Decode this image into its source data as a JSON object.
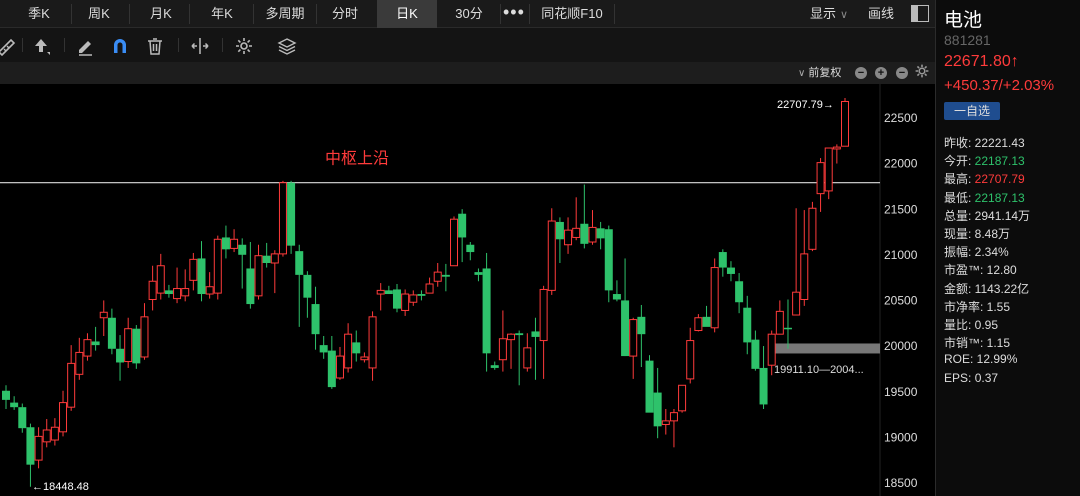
{
  "tabs": [
    {
      "label": "季K",
      "active": false
    },
    {
      "label": "周K",
      "active": false
    },
    {
      "label": "月K",
      "active": false
    },
    {
      "label": "年K",
      "active": false
    },
    {
      "label": "多周期",
      "active": false
    },
    {
      "label": "分时",
      "active": false
    },
    {
      "label": "日K",
      "active": true
    },
    {
      "label": "30分",
      "active": false
    },
    {
      "label": "同花顺F10",
      "active": false
    }
  ],
  "more_label": "•••",
  "display_label": "显示",
  "draw_label": "画线",
  "adjust_label": "前复权",
  "zoom_out_glyph": "−",
  "zoom_in_glyph": "+",
  "colors": {
    "up": "#ff3b3b",
    "down": "#2ec26b",
    "line": "#dddddd"
  },
  "chart_data": {
    "type": "candlestick",
    "y_ticks": [
      22500,
      22000,
      21500,
      21000,
      20500,
      20000,
      19500,
      19000,
      18500
    ],
    "ylim": [
      18450,
      22720
    ],
    "annotation": "中枢上沿",
    "hline_value": 21780,
    "max_label": "22707.79→",
    "min_label": "←18448.48",
    "range_label": "19911.10—2004...",
    "range_band": [
      19911.1,
      20040
    ],
    "candles": [
      [
        19500,
        19400,
        19560,
        19300
      ],
      [
        19370,
        19320,
        19440,
        19290
      ],
      [
        19320,
        19090,
        19360,
        19040
      ],
      [
        19100,
        18690,
        19140,
        18448
      ],
      [
        18740,
        19000,
        19100,
        18650
      ],
      [
        18940,
        19070,
        19190,
        18880
      ],
      [
        18960,
        19100,
        19200,
        18900
      ],
      [
        19050,
        19370,
        19500,
        19000
      ],
      [
        19320,
        19800,
        20000,
        19280
      ],
      [
        19680,
        19920,
        20080,
        19620
      ],
      [
        19880,
        20060,
        20130,
        19830
      ],
      [
        20040,
        20000,
        20200,
        19940
      ],
      [
        20300,
        20360,
        20490,
        20100
      ],
      [
        20300,
        19960,
        20400,
        19900
      ],
      [
        19960,
        19810,
        20110,
        19610
      ],
      [
        19820,
        20180,
        20300,
        19750
      ],
      [
        20180,
        19800,
        20220,
        19740
      ],
      [
        19870,
        20310,
        20460,
        19840
      ],
      [
        20500,
        20700,
        20870,
        20380
      ],
      [
        20570,
        20870,
        21000,
        20500
      ],
      [
        20600,
        20560,
        20660,
        20520
      ],
      [
        20510,
        20620,
        20850,
        20460
      ],
      [
        20540,
        20620,
        20830,
        20480
      ],
      [
        20710,
        20940,
        21010,
        20600
      ],
      [
        20950,
        20560,
        21140,
        20480
      ],
      [
        20560,
        20640,
        20800,
        20510
      ],
      [
        20570,
        21160,
        21200,
        20500
      ],
      [
        21180,
        21050,
        21310,
        20950
      ],
      [
        21060,
        21160,
        21270,
        21020
      ],
      [
        21100,
        20990,
        21170,
        20620
      ],
      [
        20840,
        20450,
        21130,
        20400
      ],
      [
        20540,
        20980,
        21100,
        20500
      ],
      [
        20980,
        20900,
        21120,
        20850
      ],
      [
        20900,
        21000,
        21040,
        20570
      ],
      [
        21000,
        21780,
        21800,
        20970
      ],
      [
        21780,
        21090,
        21800,
        21000
      ],
      [
        21030,
        20770,
        21100,
        20200
      ],
      [
        20770,
        20520,
        20810,
        20300
      ],
      [
        20450,
        20120,
        20640,
        19950
      ],
      [
        20000,
        19920,
        20100,
        19850
      ],
      [
        19940,
        19540,
        20100,
        19520
      ],
      [
        19640,
        19880,
        19980,
        19620
      ],
      [
        19750,
        20120,
        20240,
        19700
      ],
      [
        20030,
        19910,
        20160,
        19820
      ],
      [
        19840,
        19870,
        19920,
        19810
      ],
      [
        19750,
        20310,
        20370,
        19610
      ],
      [
        20560,
        20600,
        20680,
        20380
      ],
      [
        20600,
        20560,
        20650,
        20560
      ],
      [
        20610,
        20400,
        20670,
        20360
      ],
      [
        20380,
        20560,
        20610,
        20320
      ],
      [
        20470,
        20550,
        20600,
        20430
      ],
      [
        20560,
        20540,
        20600,
        20490
      ],
      [
        20570,
        20670,
        20740,
        20580
      ],
      [
        20700,
        20800,
        20900,
        20640
      ],
      [
        20770,
        20750,
        20890,
        20590
      ],
      [
        20870,
        21380,
        21410,
        20880
      ],
      [
        21440,
        21180,
        21490,
        20910
      ],
      [
        21100,
        21020,
        21130,
        20930
      ],
      [
        20800,
        20770,
        20840,
        20700
      ],
      [
        20840,
        19910,
        21010,
        19710
      ],
      [
        19780,
        19750,
        19820,
        19730
      ],
      [
        19840,
        20070,
        20380,
        19710
      ],
      [
        20060,
        20120,
        20130,
        19740
      ],
      [
        20130,
        20110,
        20160,
        19560
      ],
      [
        19750,
        19970,
        20130,
        19710
      ],
      [
        20150,
        20090,
        20300,
        19620
      ],
      [
        20050,
        20610,
        20650,
        19630
      ],
      [
        20600,
        21360,
        21500,
        20550
      ],
      [
        21350,
        21160,
        21400,
        20900
      ],
      [
        21100,
        21260,
        21400,
        21000
      ],
      [
        21180,
        21280,
        21620,
        21150
      ],
      [
        21330,
        21110,
        21760,
        21060
      ],
      [
        21130,
        21290,
        21480,
        21100
      ],
      [
        21280,
        21170,
        21350,
        21050
      ],
      [
        21270,
        20600,
        21310,
        20470
      ],
      [
        20560,
        20500,
        20710,
        20480
      ],
      [
        20490,
        19880,
        20950,
        19880
      ],
      [
        19880,
        20280,
        20300,
        19630
      ],
      [
        20310,
        20120,
        20440,
        19760
      ],
      [
        19830,
        19260,
        19890,
        19270
      ],
      [
        19480,
        19110,
        19750,
        18980
      ],
      [
        19130,
        19170,
        19300,
        19020
      ],
      [
        19170,
        19260,
        19300,
        18880
      ],
      [
        19280,
        19560,
        19540,
        19260
      ],
      [
        19630,
        20050,
        20190,
        19580
      ],
      [
        20160,
        20300,
        20340,
        20150
      ],
      [
        20310,
        20200,
        20430,
        20210
      ],
      [
        20190,
        20850,
        20950,
        20140
      ],
      [
        21020,
        20850,
        21050,
        20750
      ],
      [
        20850,
        20780,
        20920,
        20700
      ],
      [
        20700,
        20470,
        20790,
        20350
      ],
      [
        20410,
        20030,
        20540,
        19900
      ],
      [
        20060,
        19740,
        20160,
        19720
      ],
      [
        19750,
        19350,
        19990,
        19300
      ],
      [
        19780,
        20120,
        20160,
        19670
      ],
      [
        20120,
        20370,
        20490,
        20120
      ],
      [
        20190,
        20180,
        20500,
        19960
      ],
      [
        20330,
        20580,
        21500,
        20390
      ],
      [
        20500,
        21000,
        21480,
        20430
      ],
      [
        21050,
        21500,
        21570,
        21030
      ],
      [
        21660,
        22000,
        22050,
        21460
      ],
      [
        21690,
        22160,
        22160,
        21600
      ],
      [
        22150,
        22170,
        22200,
        21990
      ],
      [
        22180,
        22670,
        22707.79,
        22180
      ]
    ]
  },
  "quote": {
    "name": "电池",
    "code": "881281",
    "price": "22671.80↑",
    "change": "+450.37/+2.03%",
    "fav_label": "一自选",
    "rows": [
      {
        "label": "昨收:",
        "value": "22221.43",
        "tone": ""
      },
      {
        "label": "今开:",
        "value": "22187.13",
        "tone": "green"
      },
      {
        "label": "最高:",
        "value": "22707.79",
        "tone": "red"
      },
      {
        "label": "最低:",
        "value": "22187.13",
        "tone": "green"
      },
      {
        "label": "总量:",
        "value": "2941.14万",
        "tone": ""
      },
      {
        "label": "现量:",
        "value": "8.48万",
        "tone": ""
      },
      {
        "label": "振幅:",
        "value": "2.34%",
        "tone": ""
      },
      {
        "label": "市盈™:",
        "value": "12.80",
        "tone": ""
      },
      {
        "label": "金额:",
        "value": "1143.22亿",
        "tone": ""
      },
      {
        "label": "市净率:",
        "value": "1.55",
        "tone": ""
      },
      {
        "label": "量比:",
        "value": "0.95",
        "tone": ""
      },
      {
        "label": "市销™:",
        "value": "1.15",
        "tone": ""
      },
      {
        "label": "ROE:",
        "value": "12.99%",
        "tone": ""
      },
      {
        "label": "EPS:",
        "value": "0.37",
        "tone": ""
      }
    ]
  }
}
